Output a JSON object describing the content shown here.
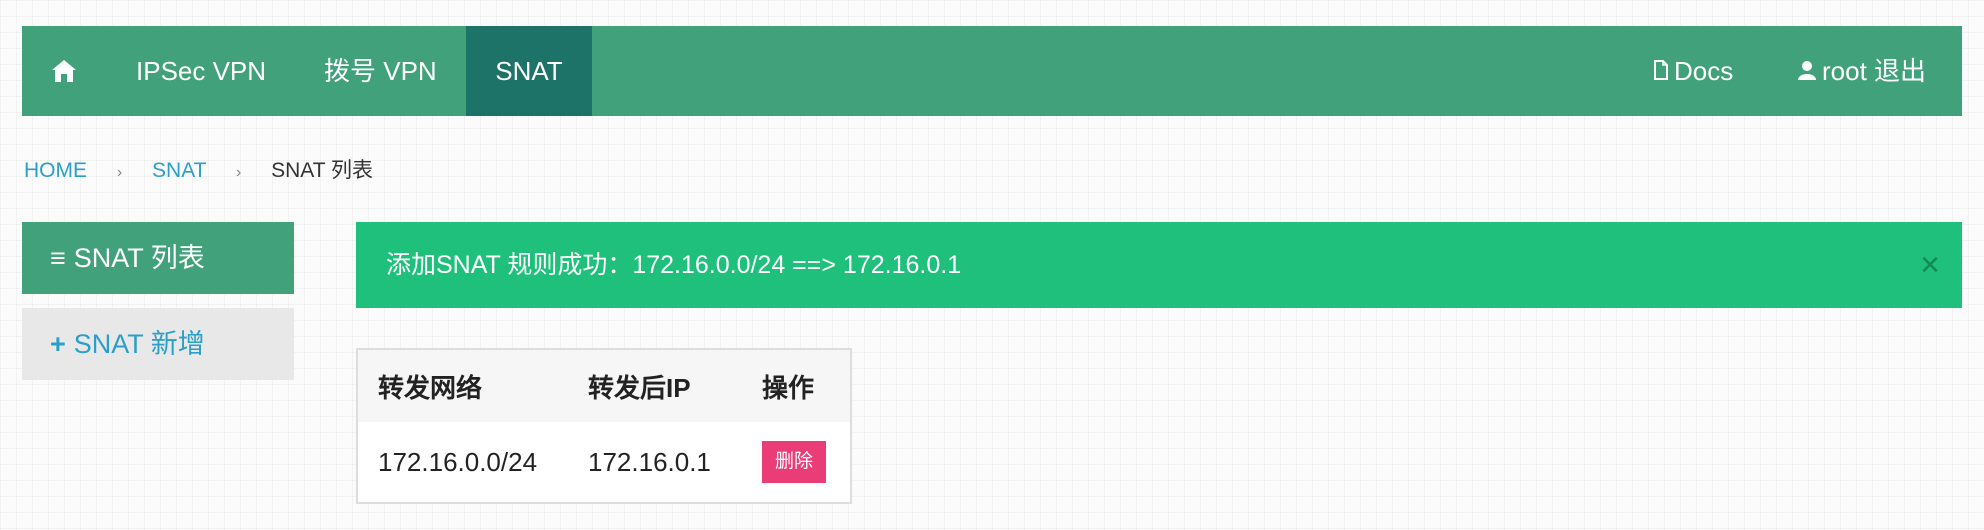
{
  "navbar": {
    "home_icon": "home-icon",
    "items": [
      {
        "label": "IPSec VPN"
      },
      {
        "label": "拨号 VPN"
      },
      {
        "label": "SNAT"
      }
    ],
    "active_item": "SNAT",
    "docs": {
      "label": "Docs",
      "icon": "document-icon"
    },
    "user": {
      "label": "root 退出",
      "icon": "user-icon"
    }
  },
  "breadcrumb": {
    "items": [
      "HOME",
      "SNAT",
      "SNAT 列表"
    ],
    "separator": "›"
  },
  "sidebar": {
    "items": [
      {
        "label": "SNAT 列表",
        "icon": "list-icon",
        "glyph": "≡"
      },
      {
        "label": "SNAT 新增",
        "icon": "plus-icon",
        "glyph": "+"
      }
    ]
  },
  "alert": {
    "message": "添加SNAT 规则成功：172.16.0.0/24 ==> 172.16.0.1",
    "close_glyph": "×"
  },
  "table": {
    "headers": [
      "转发网络",
      "转发后IP",
      "操作"
    ],
    "rows": [
      {
        "network": "172.16.0.0/24",
        "ip": "172.16.0.1",
        "action": "删除"
      }
    ]
  },
  "colors": {
    "navbar": "#41a17b",
    "nav_active": "#1e7368",
    "alert": "#1ec07b",
    "link": "#2a9fc7",
    "delete_button": "#ea3d78"
  }
}
